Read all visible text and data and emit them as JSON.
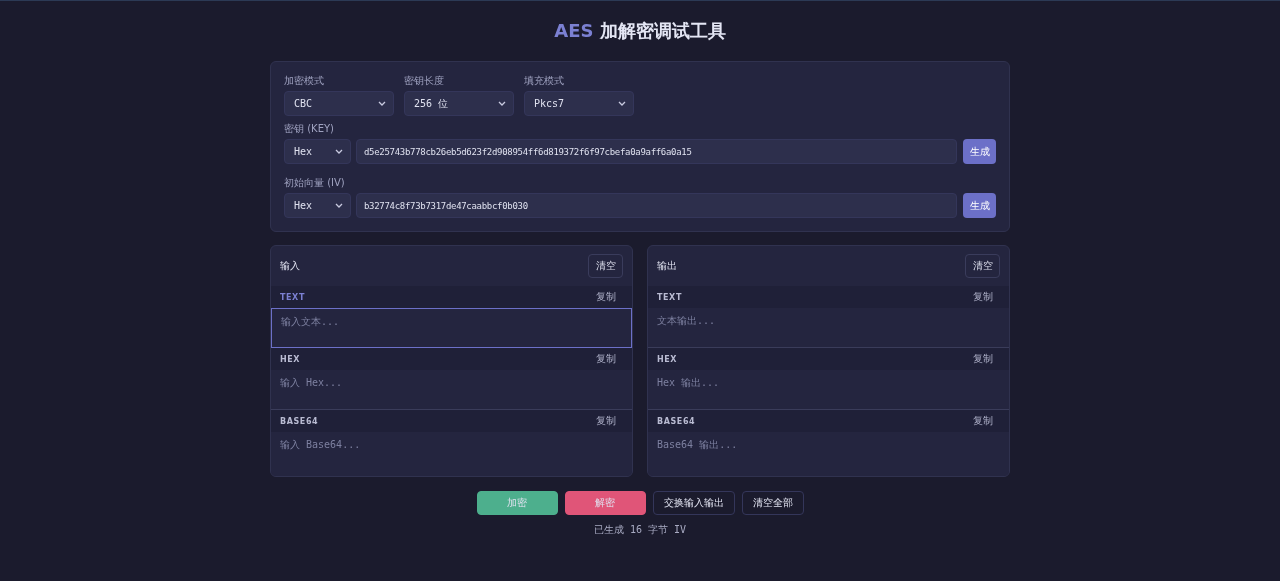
{
  "title": {
    "accent": "AES",
    "text": "加解密调试工具"
  },
  "config": {
    "selects": [
      {
        "label": "加密模式",
        "value": "CBC"
      },
      {
        "label": "密钥长度",
        "value": "256 位"
      },
      {
        "label": "填充模式",
        "value": "Pkcs7"
      }
    ],
    "key": {
      "label": "密钥 (KEY)",
      "format": "Hex",
      "value": "d5e25743b778cb26eb5d623f2d908954ff6d819372f6f97cbefa0a9aff6a0a15",
      "button": "生成"
    },
    "iv": {
      "label": "初始向量 (IV)",
      "format": "Hex",
      "value": "b32774c8f73b7317de47caabbcf0b030",
      "button": "生成"
    }
  },
  "panels": [
    {
      "title": "输入",
      "clear": "清空",
      "sections": [
        {
          "label": "TEXT",
          "copy": "复制",
          "placeholder": "输入文本...",
          "focused": true
        },
        {
          "label": "HEX",
          "copy": "复制",
          "placeholder": "输入 Hex...",
          "focused": false
        },
        {
          "label": "BASE64",
          "copy": "复制",
          "placeholder": "输入 Base64...",
          "focused": false
        }
      ]
    },
    {
      "title": "输出",
      "clear": "清空",
      "sections": [
        {
          "label": "TEXT",
          "copy": "复制",
          "placeholder": "文本输出...",
          "focused": false
        },
        {
          "label": "HEX",
          "copy": "复制",
          "placeholder": "Hex 输出...",
          "focused": false
        },
        {
          "label": "BASE64",
          "copy": "复制",
          "placeholder": "Base64 输出...",
          "focused": false
        }
      ]
    }
  ],
  "actions": [
    {
      "label": "加密",
      "kind": "encrypt"
    },
    {
      "label": "解密",
      "kind": "decrypt"
    },
    {
      "label": "交换输入输出",
      "kind": "plain"
    },
    {
      "label": "清空全部",
      "kind": "plain"
    }
  ],
  "status": "已生成 16 字节 IV"
}
